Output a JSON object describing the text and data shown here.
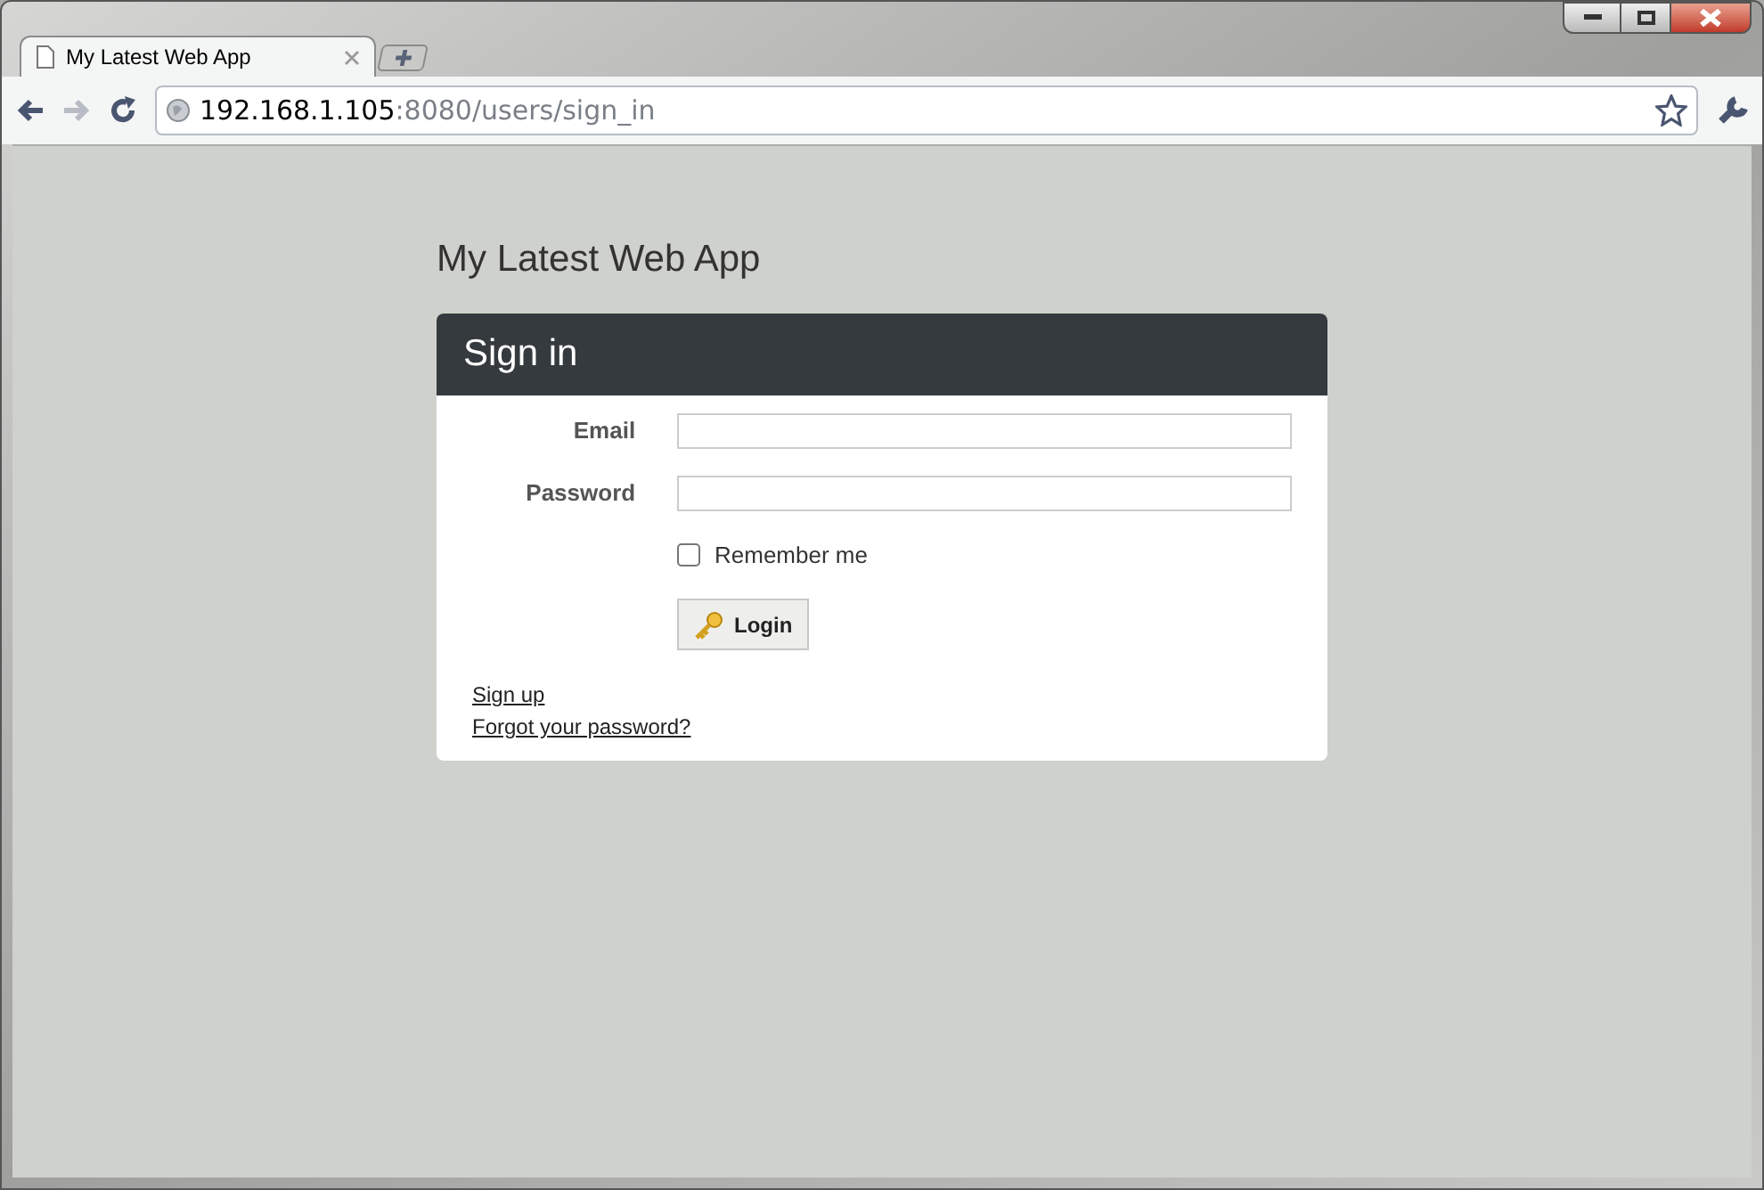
{
  "tabs": [
    {
      "title": "My Latest Web App",
      "selected": true
    }
  ],
  "address": {
    "host": "192.168.1.105",
    "path": ":8080/users/sign_in"
  },
  "page": {
    "app_title": "My Latest Web App",
    "panel_title": "Sign in",
    "fields": [
      {
        "label": "Email"
      },
      {
        "label": "Password"
      }
    ],
    "remember": {
      "label": "Remember me",
      "checked": false
    },
    "login_button": "Login",
    "links": [
      "Sign up",
      "Forgot your password?"
    ]
  }
}
